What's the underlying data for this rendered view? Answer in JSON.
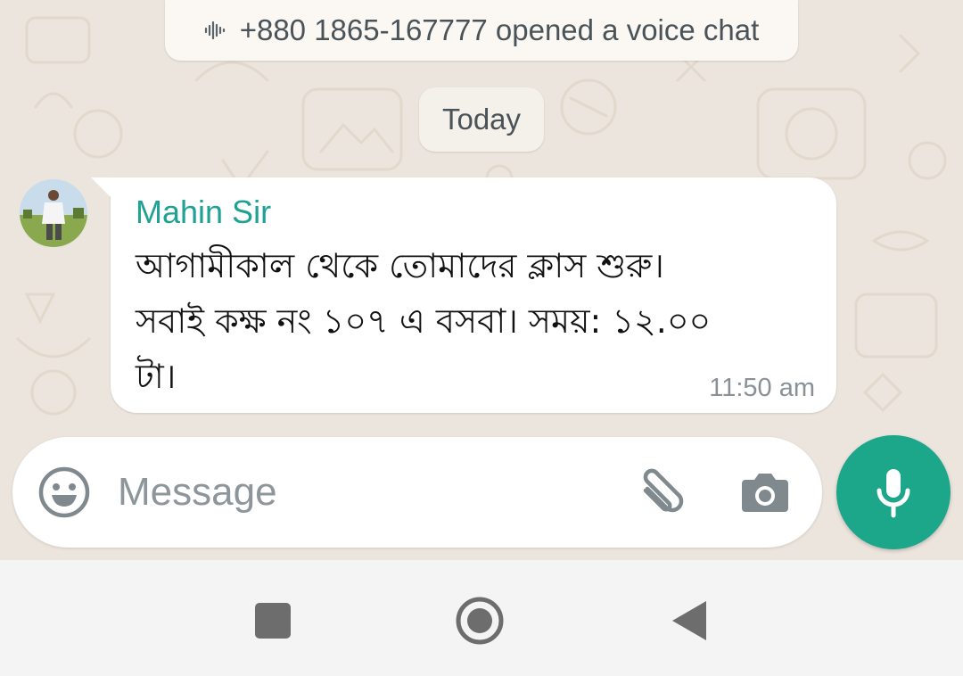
{
  "system_message": {
    "icon": "voice-wave-icon",
    "text": "+880 1865-167777 opened a voice chat"
  },
  "date_divider": "Today",
  "message": {
    "sender": "Mahin Sir",
    "lines": [
      "আগামীকাল থেকে তোমাদের ক্লাস শুরু।",
      "সবাই কক্ষ নং ১০৭ এ বসবা। সময়: ১২.০০",
      "টা।"
    ],
    "time": "11:50 am",
    "avatar": "avatar-photo"
  },
  "composer": {
    "placeholder": "Message",
    "value": "",
    "icons": [
      "emoji-icon",
      "paperclip-icon",
      "camera-icon"
    ]
  },
  "mic_button": {
    "icon": "microphone-icon",
    "color": "#1ca68a"
  },
  "navbar": {
    "icons": [
      "recents-square-icon",
      "home-circle-icon",
      "back-triangle-icon"
    ]
  },
  "colors": {
    "sender_name": "#1fa293",
    "chat_background": "#ece5dd",
    "bubble": "#ffffff"
  }
}
